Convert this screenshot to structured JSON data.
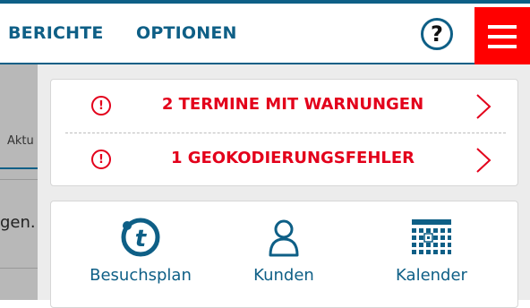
{
  "header": {
    "nav": [
      {
        "label": "BERICHTE"
      },
      {
        "label": "OPTIONEN"
      }
    ],
    "help_label": "?"
  },
  "background": {
    "tab_text": "Aktu",
    "body_text": "gen."
  },
  "alerts": [
    {
      "label": "2 TERMINE MIT WARNUNGEN",
      "icon": "exclamation-circle-icon"
    },
    {
      "label": "1 GEOKODIERUNGSFEHLER",
      "icon": "exclamation-circle-icon"
    }
  ],
  "tiles": [
    {
      "label": "Besuchsplan",
      "icon": "tour-logo-icon"
    },
    {
      "label": "Kunden",
      "icon": "person-icon"
    },
    {
      "label": "Kalender",
      "icon": "calendar-icon"
    }
  ],
  "colors": {
    "primary": "#0e5f86",
    "alert": "#e3001b",
    "menu_bg": "#ff0000"
  }
}
